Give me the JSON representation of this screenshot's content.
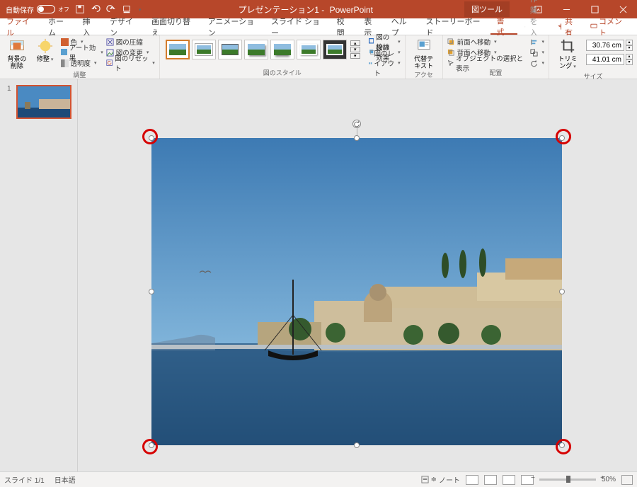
{
  "titlebar": {
    "autosave_label": "自動保存",
    "autosave_state": "オフ",
    "doc_title": "プレゼンテーション1",
    "app_name": "PowerPoint",
    "tool_tab": "図ツール"
  },
  "tabs": {
    "items": [
      "ファイル",
      "ホーム",
      "挿入",
      "デザイン",
      "画面切り替え",
      "アニメーション",
      "スライド ショー",
      "校閲",
      "表示",
      "ヘルプ",
      "ストーリーボード",
      "書式"
    ],
    "active_index": 11,
    "tellme_placeholder": "実行したい作業を入力してください",
    "share_label": "共有",
    "comment_label": "コメント"
  },
  "ribbon": {
    "groups": {
      "adjust": {
        "label": "調整",
        "remove_bg": "背景の\n削除",
        "corrections": "修整",
        "color": "色",
        "art_effects": "アート効果",
        "transparency": "透明度",
        "compress": "図の圧縮",
        "change": "図の変更",
        "reset": "図のリセット"
      },
      "styles": {
        "label": "図のスタイル",
        "border": "図の枠線",
        "effects": "図の効果",
        "layout": "図のレイアウト"
      },
      "access": {
        "label": "アクセシ…",
        "alt_text": "代替テ\nキスト"
      },
      "arrange": {
        "label": "配置",
        "bring_forward": "前面へ移動",
        "send_backward": "背面へ移動",
        "selection_pane": "オブジェクトの選択と表示"
      },
      "size": {
        "label": "サイズ",
        "crop": "トリミング",
        "height": "30.76 cm",
        "width": "41.01 cm"
      }
    }
  },
  "slides": {
    "count": 1,
    "current": 1
  },
  "statusbar": {
    "slide_counter": "スライド 1/1",
    "language": "日本語",
    "notes": "ノート",
    "zoom_pct": "50%"
  }
}
